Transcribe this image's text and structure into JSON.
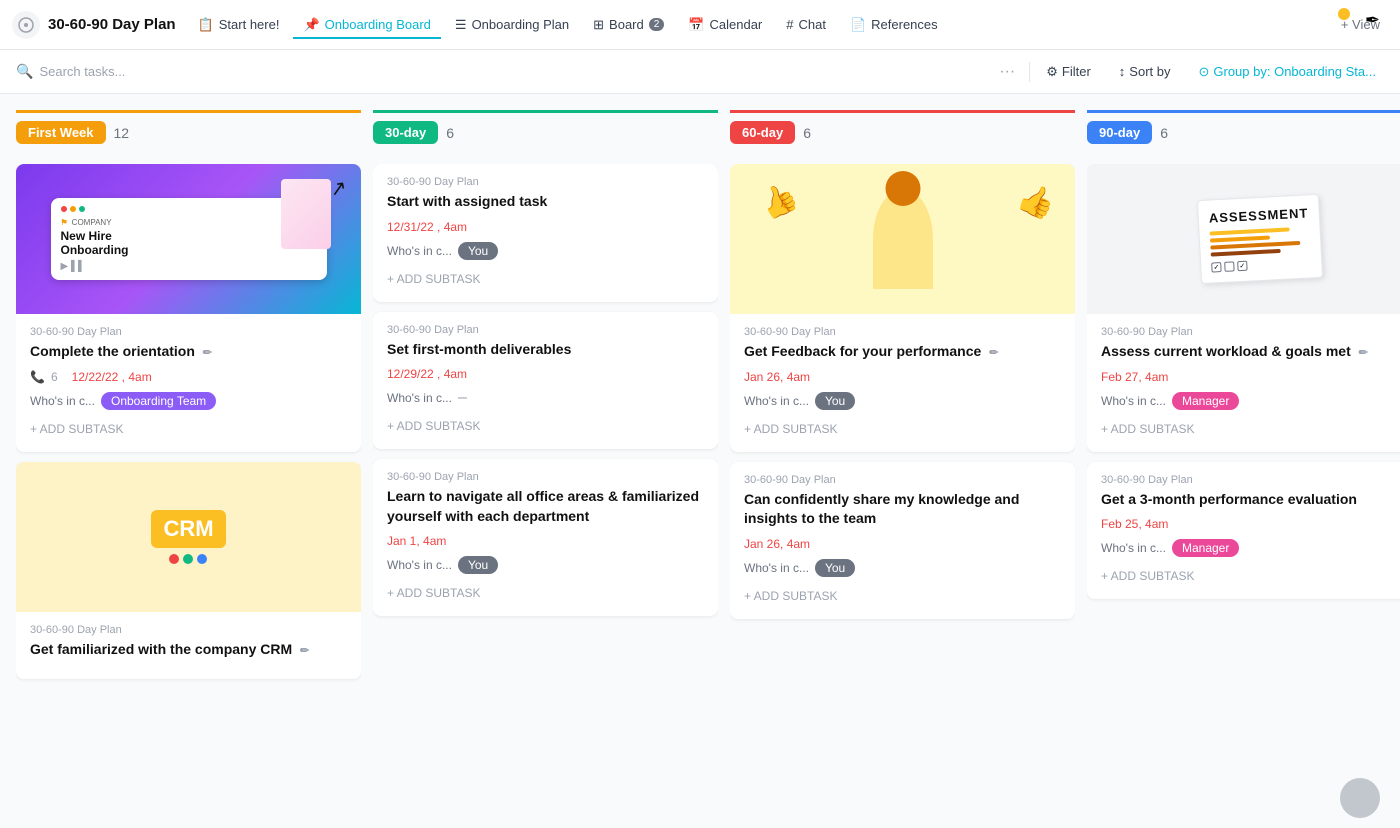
{
  "app": {
    "icon": "grid-icon",
    "title": "30-60-90 Day Plan"
  },
  "nav": {
    "items": [
      {
        "id": "start-here",
        "label": "Start here!",
        "icon": "📋",
        "active": false
      },
      {
        "id": "onboarding-board",
        "label": "Onboarding Board",
        "icon": "📌",
        "active": true
      },
      {
        "id": "onboarding-plan",
        "label": "Onboarding Plan",
        "icon": "☰",
        "active": false
      },
      {
        "id": "board",
        "label": "Board",
        "icon": "⊞",
        "active": false,
        "badge": "2"
      },
      {
        "id": "calendar",
        "label": "Calendar",
        "icon": "📅",
        "active": false
      },
      {
        "id": "chat",
        "label": "Chat",
        "icon": "#",
        "active": false
      },
      {
        "id": "references",
        "label": "References",
        "icon": "📄",
        "active": false
      }
    ],
    "view_plus": "+ View"
  },
  "toolbar": {
    "search_placeholder": "Search tasks...",
    "filter_label": "Filter",
    "sort_label": "Sort by",
    "group_label": "Group by: Onboarding Sta..."
  },
  "columns": [
    {
      "id": "first-week",
      "label": "First Week",
      "count": 12,
      "color": "#f59e0b",
      "type": "first-week",
      "cards": [
        {
          "id": "fw1",
          "has_image": true,
          "image_type": "onboarding",
          "plan": "30-60-90 Day Plan",
          "title": "Complete the orientation",
          "has_edit_icon": true,
          "subtask_count": "6",
          "date": "12/22/22 , 4am",
          "assignee": "Onboarding Team",
          "assignee_type": "onboarding"
        },
        {
          "id": "fw2",
          "has_image": true,
          "image_type": "crm",
          "plan": "30-60-90 Day Plan",
          "title": "Get familiarized with the company CRM",
          "has_edit_icon": true
        }
      ]
    },
    {
      "id": "30-day",
      "label": "30-day",
      "count": 6,
      "color": "#10b981",
      "type": "day30",
      "cards": [
        {
          "id": "30d1",
          "has_image": false,
          "plan": "30-60-90 Day Plan",
          "title": "Start with assigned task",
          "date": "12/31/22 , 4am",
          "assignee_label": "Who's in c...",
          "assignee": "You",
          "assignee_type": "you"
        },
        {
          "id": "30d2",
          "has_image": false,
          "plan": "30-60-90 Day Plan",
          "title": "Set first-month deliverables",
          "date": "12/29/22 , 4am",
          "assignee_label": "Who's in c...",
          "assignee": "–",
          "assignee_type": "dash"
        },
        {
          "id": "30d3",
          "has_image": false,
          "plan": "30-60-90 Day Plan",
          "title": "Learn to navigate all office areas & familiarized yourself with each department",
          "date": "Jan 1, 4am",
          "assignee_label": "Who's in c...",
          "assignee": "You",
          "assignee_type": "you"
        }
      ]
    },
    {
      "id": "60-day",
      "label": "60-day",
      "count": 6,
      "color": "#ef4444",
      "type": "day60",
      "cards": [
        {
          "id": "60d1",
          "has_image": true,
          "image_type": "feedback",
          "plan": "30-60-90 Day Plan",
          "title": "Get Feedback for your performance",
          "has_edit_icon": true,
          "date": "Jan 26, 4am",
          "assignee_label": "Who's in c...",
          "assignee": "You",
          "assignee_type": "you"
        },
        {
          "id": "60d2",
          "has_image": false,
          "plan": "30-60-90 Day Plan",
          "title": "Can confidently share my knowledge and insights to the team",
          "date": "Jan 26, 4am",
          "assignee_label": "Who's in c...",
          "assignee": "You",
          "assignee_type": "you"
        }
      ]
    },
    {
      "id": "90-day",
      "label": "90-day",
      "count": 6,
      "color": "#3b82f6",
      "type": "day90",
      "cards": [
        {
          "id": "90d1",
          "has_image": true,
          "image_type": "assessment",
          "plan": "30-60-90 Day Plan",
          "title": "Assess current workload & goals met",
          "has_edit_icon": true,
          "date": "Feb 27, 4am",
          "assignee_label": "Who's in c...",
          "assignee": "Manager",
          "assignee_type": "manager"
        },
        {
          "id": "90d2",
          "has_image": false,
          "plan": "30-60-90 Day Plan",
          "title": "Get a 3-month performance evaluation",
          "date": "Feb 25, 4am",
          "assignee_label": "Who's in c...",
          "assignee": "Manager",
          "assignee_type": "manager"
        }
      ]
    }
  ]
}
